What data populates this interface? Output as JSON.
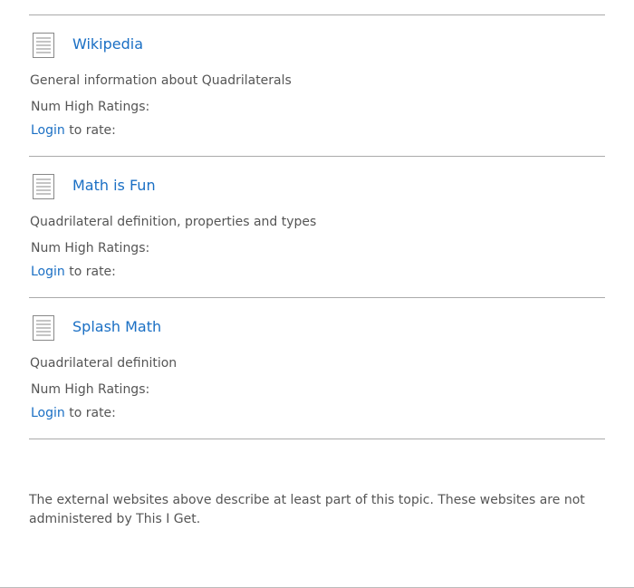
{
  "resources": [
    {
      "icon": "document-icon",
      "title": "Wikipedia",
      "description": "General information about Quadrilaterals",
      "ratings_label": "Num High Ratings:",
      "login_label": "Login",
      "rate_suffix": " to rate:"
    },
    {
      "icon": "document-icon",
      "title": "Math is Fun",
      "description": "Quadrilateral definition, properties and types",
      "ratings_label": "Num High Ratings:",
      "login_label": "Login",
      "rate_suffix": " to rate:"
    },
    {
      "icon": "document-icon",
      "title": "Splash Math",
      "description": "Quadrilateral definition",
      "ratings_label": "Num High Ratings:",
      "login_label": "Login",
      "rate_suffix": " to rate:"
    }
  ],
  "footnote": "The external websites above describe at least part of this topic. These websites are not administered by This I Get.",
  "colors": {
    "link": "#1a6fc4",
    "text": "#555555",
    "rule": "#aaaaaa"
  }
}
